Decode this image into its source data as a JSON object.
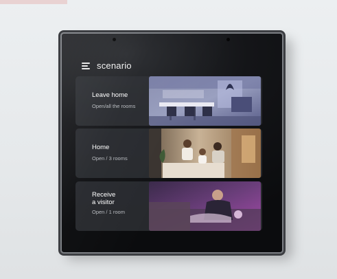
{
  "screen": {
    "title": "scenario",
    "scenes": [
      {
        "name": "Leave home",
        "name_line2": "",
        "status": "Open/all the rooms",
        "image": "empty-dining-room-photo"
      },
      {
        "name": "Home",
        "name_line2": "",
        "status": "Open / 3 rooms",
        "image": "family-living-room-photo"
      },
      {
        "name": "Receive",
        "name_line2": "a visitor",
        "status": "Open / 1 room",
        "image": "man-on-sofa-photo"
      }
    ]
  }
}
